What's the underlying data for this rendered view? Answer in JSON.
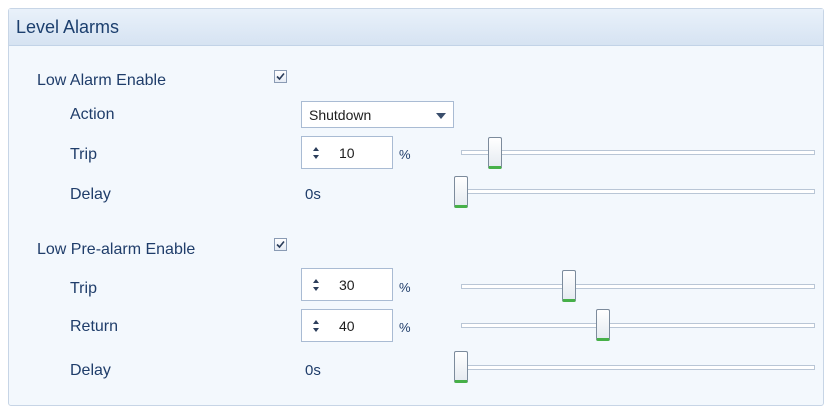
{
  "panel": {
    "title": "Level Alarms"
  },
  "low_alarm": {
    "enable_label": "Low Alarm Enable",
    "enable_checked": true,
    "action_label": "Action",
    "action_value": "Shutdown",
    "trip_label": "Trip",
    "trip_value": "10",
    "trip_unit": "%",
    "delay_label": "Delay",
    "delay_value": "0s"
  },
  "low_prealarm": {
    "enable_label": "Low Pre-alarm Enable",
    "enable_checked": true,
    "trip_label": "Trip",
    "trip_value": "30",
    "trip_unit": "%",
    "return_label": "Return",
    "return_value": "40",
    "return_unit": "%",
    "delay_label": "Delay",
    "delay_value": "0s"
  },
  "colors": {
    "header_text": "#1c3f6e",
    "label_text": "#1f3d6a",
    "slider_accent": "#46b048",
    "panel_bg": "#f3f8fd"
  },
  "icons": {
    "checkbox": "check-icon",
    "dropdown": "chevron-down-icon",
    "spinner": "spinner-arrows-icon"
  }
}
